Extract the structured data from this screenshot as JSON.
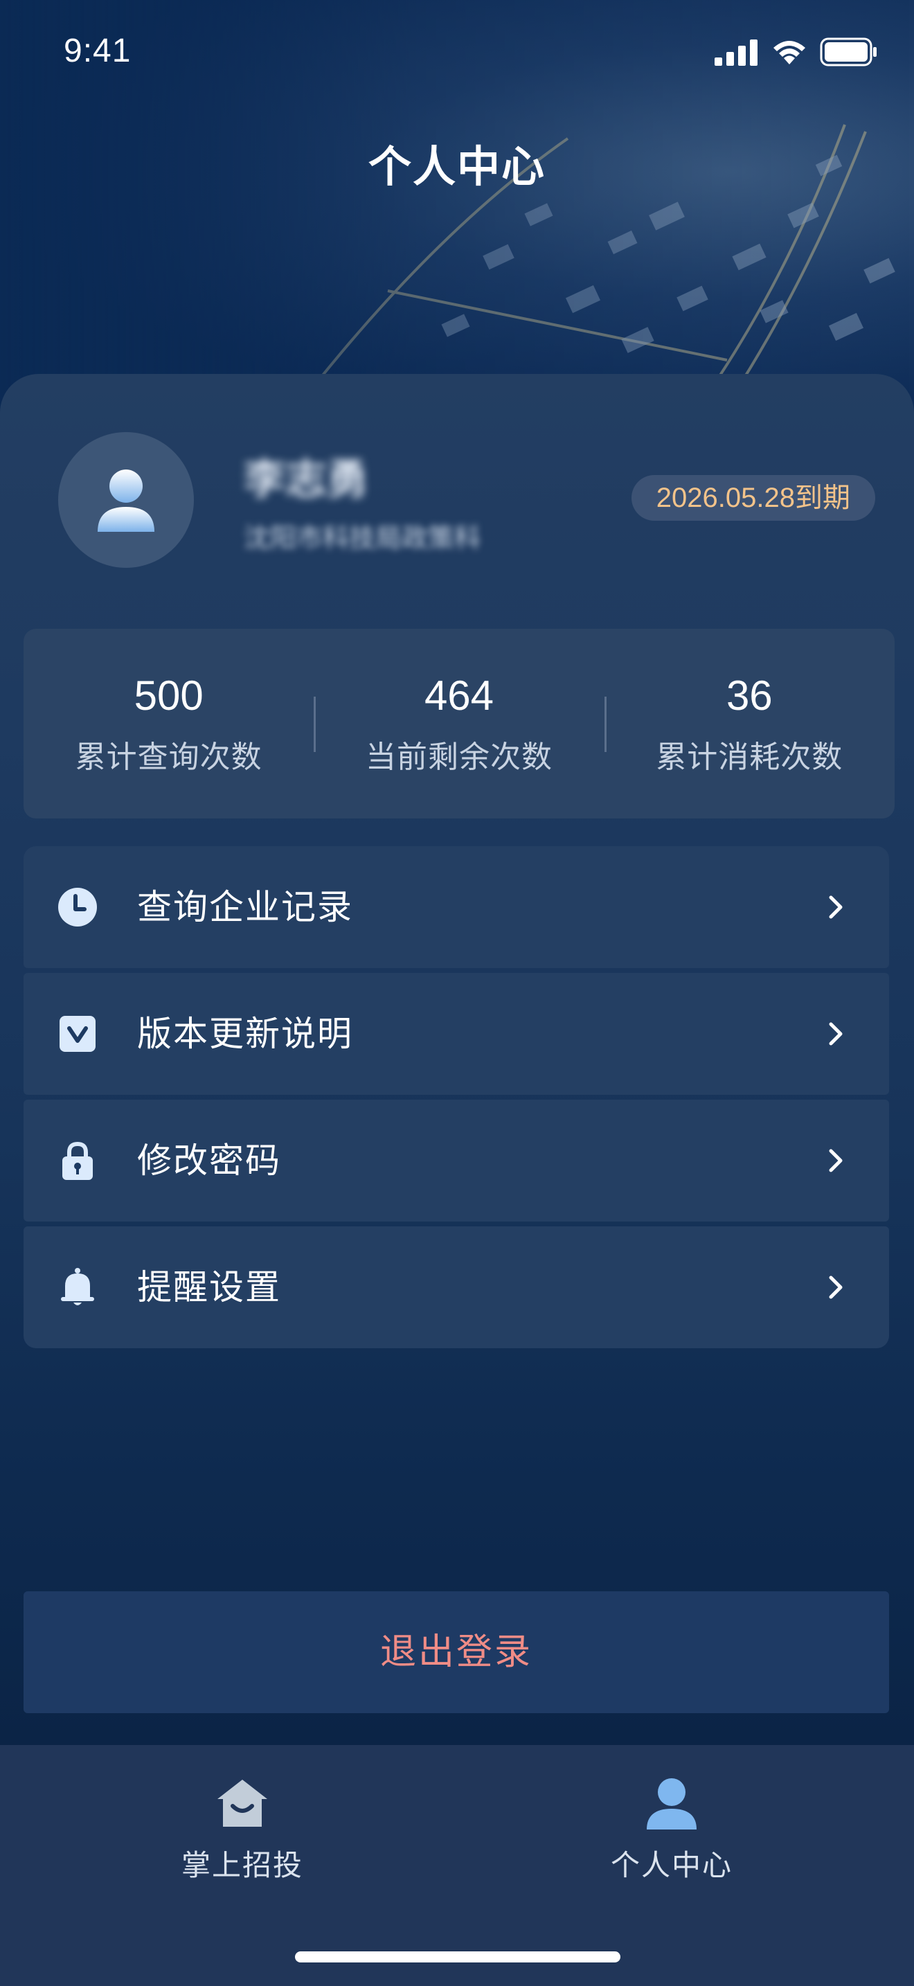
{
  "status_bar": {
    "time": "9:41"
  },
  "header": {
    "title": "个人中心"
  },
  "profile": {
    "name": "李志勇",
    "organization": "沈阳市科技局政策科",
    "expiry": "2026.05.28到期"
  },
  "stats": [
    {
      "value": "500",
      "label": "累计查询次数"
    },
    {
      "value": "464",
      "label": "当前剩余次数"
    },
    {
      "value": "36",
      "label": "累计消耗次数"
    }
  ],
  "menu": [
    {
      "label": "查询企业记录",
      "icon": "clock-icon"
    },
    {
      "label": "版本更新说明",
      "icon": "version-icon"
    },
    {
      "label": "修改密码",
      "icon": "lock-icon"
    },
    {
      "label": "提醒设置",
      "icon": "bell-icon"
    }
  ],
  "logout": {
    "label": "退出登录"
  },
  "tab_bar": {
    "tabs": [
      {
        "label": "掌上招投",
        "icon": "home-icon",
        "active": false
      },
      {
        "label": "个人中心",
        "icon": "user-icon",
        "active": true
      }
    ]
  },
  "colors": {
    "accent_badge_text": "#f3c38a",
    "logout_text": "#f08c86",
    "active_tab_icon": "#7fb7ef"
  }
}
